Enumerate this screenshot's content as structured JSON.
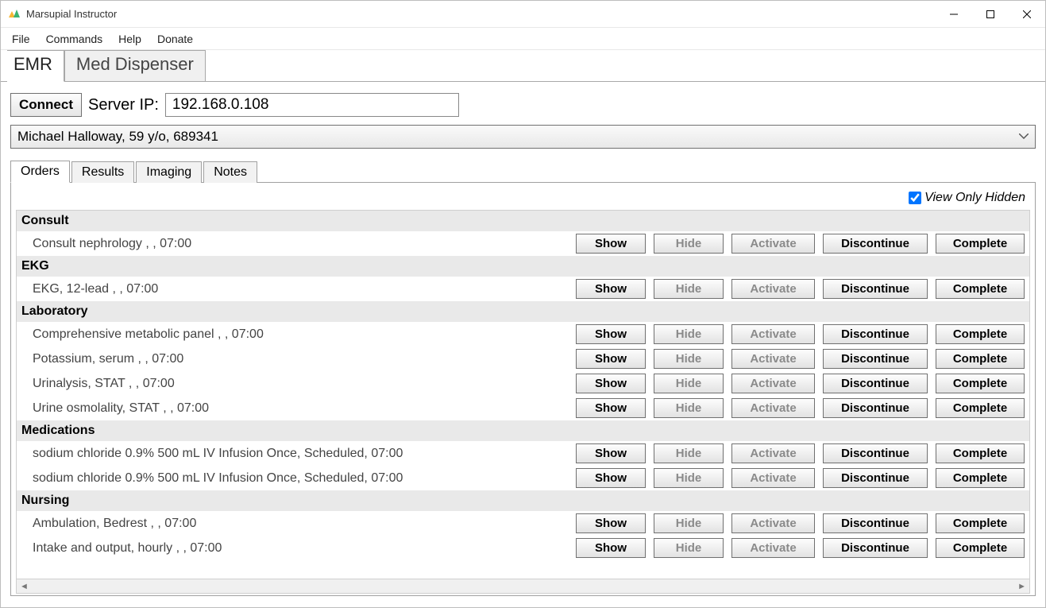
{
  "window": {
    "title": "Marsupial Instructor"
  },
  "menu": {
    "items": [
      "File",
      "Commands",
      "Help",
      "Donate"
    ]
  },
  "main_tabs": {
    "active_index": 0,
    "items": [
      "EMR",
      "Med Dispenser"
    ]
  },
  "connect": {
    "button": "Connect",
    "label": "Server IP:",
    "value": "192.168.0.108"
  },
  "patient": {
    "selected": "Michael Halloway, 59 y/o, 689341"
  },
  "sub_tabs": {
    "active_index": 0,
    "items": [
      "Orders",
      "Results",
      "Imaging",
      "Notes"
    ]
  },
  "view_only_hidden": {
    "label": "View Only Hidden",
    "checked": true
  },
  "row_buttons": {
    "show": "Show",
    "hide": "Hide",
    "activate": "Activate",
    "discontinue": "Discontinue",
    "complete": "Complete"
  },
  "orders": [
    {
      "category": "Consult",
      "items": [
        {
          "text": "Consult nephrology    , , 07:00",
          "hide_disabled": true,
          "activate_disabled": true
        }
      ]
    },
    {
      "category": "EKG",
      "items": [
        {
          "text": "EKG, 12-lead    , , 07:00",
          "hide_disabled": true,
          "activate_disabled": true
        }
      ]
    },
    {
      "category": "Laboratory",
      "items": [
        {
          "text": "Comprehensive metabolic panel    , , 07:00",
          "hide_disabled": true,
          "activate_disabled": true
        },
        {
          "text": "Potassium, serum    , , 07:00",
          "hide_disabled": true,
          "activate_disabled": true
        },
        {
          "text": "Urinalysis, STAT    , , 07:00",
          "hide_disabled": true,
          "activate_disabled": true
        },
        {
          "text": "Urine osmolality, STAT    , , 07:00",
          "hide_disabled": true,
          "activate_disabled": true
        }
      ]
    },
    {
      "category": "Medications",
      "items": [
        {
          "text": "sodium chloride 0.9% 500 mL IV Infusion Once, Scheduled, 07:00",
          "hide_disabled": true,
          "activate_disabled": true
        },
        {
          "text": "sodium chloride 0.9% 500 mL IV Infusion Once, Scheduled, 07:00",
          "hide_disabled": true,
          "activate_disabled": true
        }
      ]
    },
    {
      "category": "Nursing",
      "items": [
        {
          "text": "Ambulation, Bedrest    , , 07:00",
          "hide_disabled": true,
          "activate_disabled": true
        },
        {
          "text": "Intake and output, hourly    , , 07:00",
          "hide_disabled": true,
          "activate_disabled": true
        }
      ]
    }
  ]
}
